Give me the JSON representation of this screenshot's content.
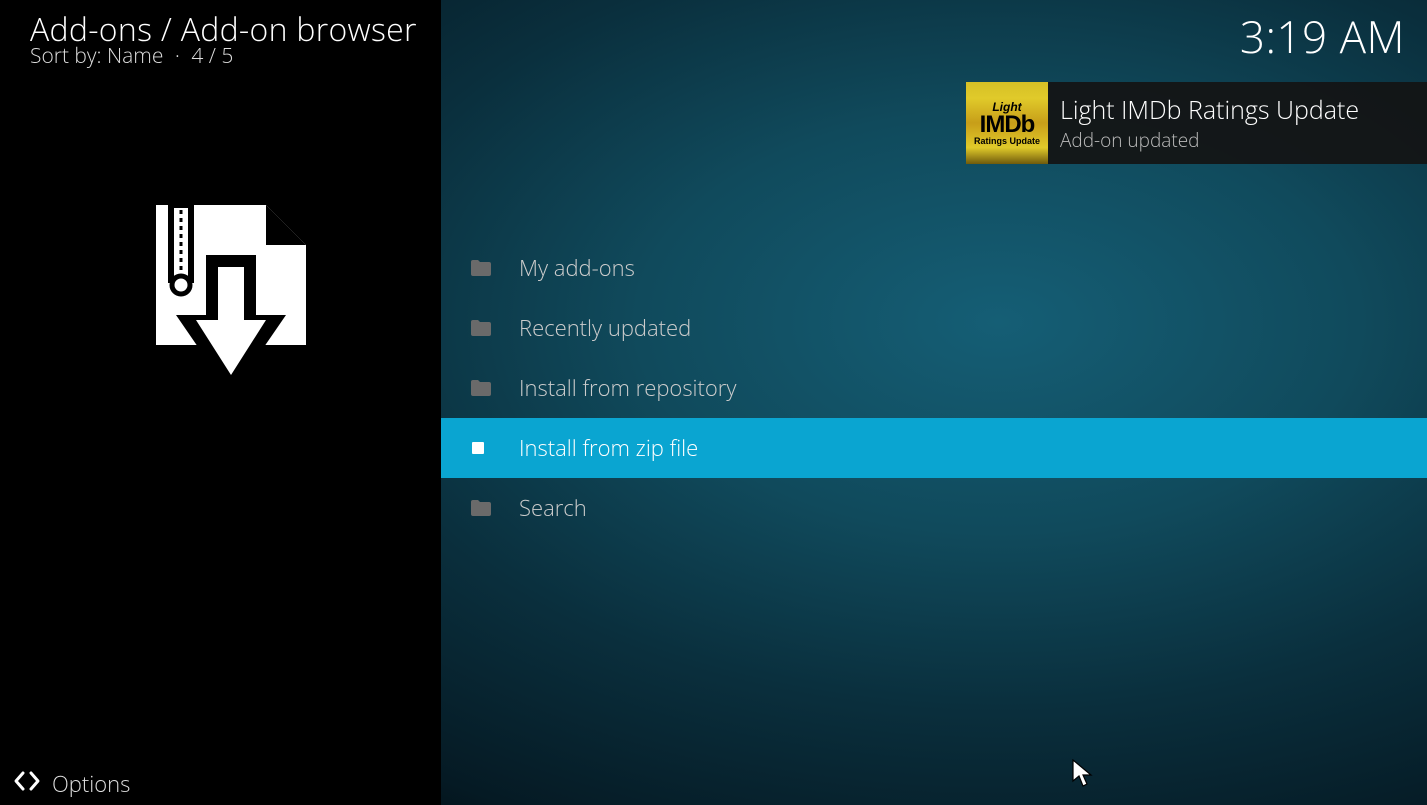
{
  "header": {
    "breadcrumb": "Add-ons / Add-on browser",
    "sort_label": "Sort by:",
    "sort_value": "Name",
    "counter": "4 / 5",
    "clock": "3:19 AM"
  },
  "menu": {
    "items": [
      {
        "label": "My add-ons",
        "icon": "folder",
        "selected": false
      },
      {
        "label": "Recently updated",
        "icon": "folder",
        "selected": false
      },
      {
        "label": "Install from repository",
        "icon": "folder",
        "selected": false
      },
      {
        "label": "Install from zip file",
        "icon": "file",
        "selected": true
      },
      {
        "label": "Search",
        "icon": "folder",
        "selected": false
      }
    ]
  },
  "toast": {
    "icon_line1": "Light",
    "icon_line2": "IMDb",
    "icon_line3": "Ratings Update",
    "title": "Light IMDb Ratings Update",
    "subtitle": "Add-on updated"
  },
  "footer": {
    "options": "Options"
  }
}
